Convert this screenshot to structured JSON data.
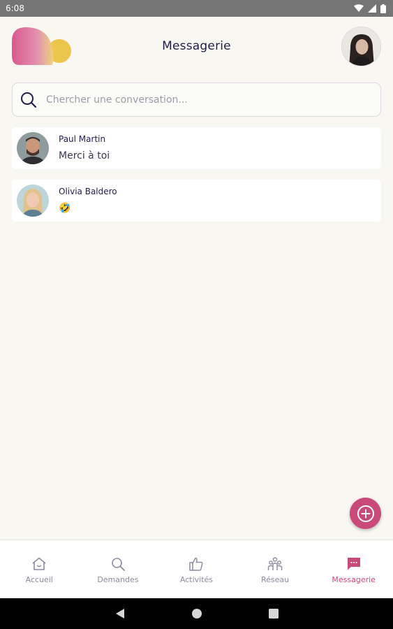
{
  "status_bar": {
    "time": "6:08"
  },
  "header": {
    "title": "Messagerie"
  },
  "search": {
    "placeholder": "Chercher une conversation..."
  },
  "conversations": [
    {
      "name": "Paul Martin",
      "preview": "Merci à toi"
    },
    {
      "name": "Olivia Baldero",
      "preview": "🤣"
    }
  ],
  "bottom_nav": [
    {
      "label": "Accueil",
      "icon": "home-icon",
      "active": false
    },
    {
      "label": "Demandes",
      "icon": "search-icon",
      "active": false
    },
    {
      "label": "Activités",
      "icon": "thumbs-up-icon",
      "active": false
    },
    {
      "label": "Réseau",
      "icon": "people-icon",
      "active": false
    },
    {
      "label": "Messagerie",
      "icon": "chat-icon",
      "active": true
    }
  ],
  "colors": {
    "accent": "#c9497b",
    "background": "#f9f7f2",
    "title_text": "#1f1d4a",
    "inactive_nav": "#8c8aa0"
  }
}
